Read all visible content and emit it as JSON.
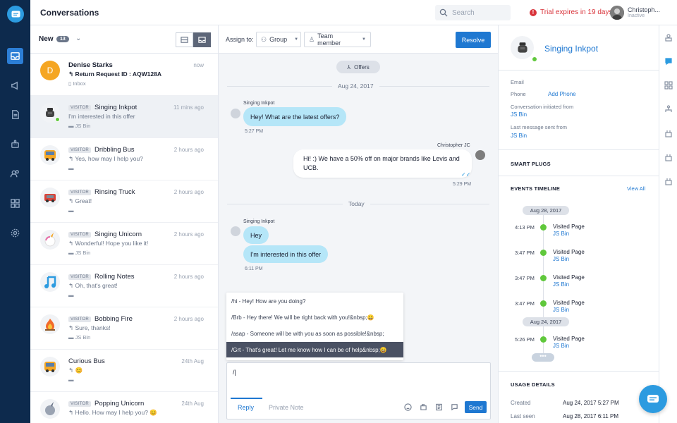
{
  "header": {
    "title": "Conversations",
    "search_placeholder": "Search",
    "trial": "Trial expires in 19 days",
    "user_name": "Christoph...",
    "user_status": "Inactive"
  },
  "list": {
    "filter_label": "New",
    "filter_count": "13",
    "items": [
      {
        "name": "Denise Starks",
        "visitor": "",
        "time": "now",
        "msg": "Return Request ID : AQW128A",
        "src": "Inbox",
        "initial": "D"
      },
      {
        "name": "Singing Inkpot",
        "visitor": "VISITOR",
        "time": "11 mins ago",
        "msg": "I'm interested in this offer",
        "src": "JS Bin"
      },
      {
        "name": "Dribbling Bus",
        "visitor": "VISITOR",
        "time": "2 hours ago",
        "msg": "Yes, how may I help you?",
        "src": ""
      },
      {
        "name": "Rinsing Truck",
        "visitor": "VISITOR",
        "time": "2 hours ago",
        "msg": "Great!",
        "src": ""
      },
      {
        "name": "Singing Unicorn",
        "visitor": "VISITOR",
        "time": "2 hours ago",
        "msg": "Wonderful! Hope you like it!",
        "src": "JS Bin"
      },
      {
        "name": "Rolling Notes",
        "visitor": "VISITOR",
        "time": "2 hours ago",
        "msg": "Oh, that's great!",
        "src": ""
      },
      {
        "name": "Bobbing Fire",
        "visitor": "VISITOR",
        "time": "2 hours ago",
        "msg": "Sure, thanks!",
        "src": "JS Bin"
      },
      {
        "name": "Curious Bus",
        "visitor": "",
        "time": "24th Aug",
        "msg": "😊",
        "src": ""
      },
      {
        "name": "Popping Unicorn",
        "visitor": "VISITOR",
        "time": "24th Aug",
        "msg": "Hello. How may I help you? 😊",
        "src": ""
      }
    ]
  },
  "chat": {
    "assign_label": "Assign to:",
    "group": "Group",
    "team_member": "Team member",
    "resolve": "Resolve",
    "offers": "Offers",
    "date1": "Aug 24, 2017",
    "date2": "Today",
    "visitor_name": "Singing Inkpot",
    "agent_name": "Christopher JC",
    "m1": "Hey! What are the latest offers?",
    "m1_time": "5:27 PM",
    "m2": "Hi! :) We have a 50% off on major brands like Levis and UCB.",
    "m2_time": "5:29 PM",
    "m3": "Hey",
    "m4": "I'm interested in this offer",
    "m4_time": "6:11 PM",
    "canned": [
      "/hi - Hey! How are you doing?",
      "/Brb - Hey there! We will be right back with you!&nbsp;😀",
      "/asap - Someone will be with you as soon as possible!&nbsp;",
      "/Grt - That's great! Let me know how I can be of help&nbsp;😀"
    ],
    "composer_text": "/|",
    "tab_reply": "Reply",
    "tab_note": "Private Note",
    "send": "Send"
  },
  "profile": {
    "name": "Singing Inkpot",
    "email_label": "Email",
    "phone_label": "Phone",
    "add_phone": "Add Phone",
    "init_label": "Conversation initiated from",
    "init_val": "JS Bin",
    "last_label": "Last message sent from",
    "last_val": "JS Bin",
    "smart_plugs": "SMART PLUGS",
    "events": "EVENTS TIMELINE",
    "view_all": "View All",
    "tdate1": "Aug 28, 2017",
    "tdate2": "Aug 24, 2017",
    "events_list": [
      {
        "time": "4:13 PM",
        "label": "Visited Page",
        "sub": "JS Bin"
      },
      {
        "time": "3:47 PM",
        "label": "Visited Page",
        "sub": "JS Bin"
      },
      {
        "time": "3:47 PM",
        "label": "Visited Page",
        "sub": "JS Bin"
      },
      {
        "time": "3:47 PM",
        "label": "Visited Page",
        "sub": "JS Bin"
      },
      {
        "time": "5:26 PM",
        "label": "Visited Page",
        "sub": "JS Bin"
      }
    ],
    "more": "•••",
    "usage": "USAGE DETAILS",
    "created_label": "Created",
    "created_val": "Aug 24, 2017 5:27 PM",
    "seen_label": "Last seen",
    "seen_val": "Aug 28, 2017 6:11 PM"
  },
  "colors": {
    "nav": "#0d2a4d",
    "accent": "#1f78d1",
    "bubble": "#b5e6f8",
    "online": "#60c83c",
    "alert": "#d9343b"
  }
}
